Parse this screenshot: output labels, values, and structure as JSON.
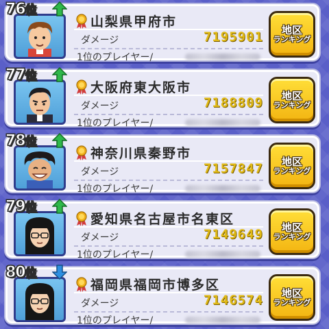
{
  "labels": {
    "rank_suffix": "位",
    "damage": "ダメージ",
    "top_player": "1位のプレイヤー/",
    "button_line1": "地区",
    "button_line2": "ランキング"
  },
  "entries": [
    {
      "rank": "76",
      "trend": "up",
      "region": "山梨県甲府市",
      "damage": "7195901",
      "avatar": "boy-brown-hair"
    },
    {
      "rank": "77",
      "trend": "up",
      "region": "大阪府東大阪市",
      "damage": "7188809",
      "avatar": "man-dark-hair"
    },
    {
      "rank": "78",
      "trend": "up",
      "region": "神奈川県秦野市",
      "damage": "7157847",
      "avatar": "boy-afro-grin"
    },
    {
      "rank": "79",
      "trend": "up",
      "region": "愛知県名古屋市名東区",
      "damage": "7149649",
      "avatar": "girl-glasses"
    },
    {
      "rank": "80",
      "trend": "down",
      "region": "福岡県福岡市博多区",
      "damage": "7146574",
      "avatar": "girl-glasses"
    }
  ],
  "colors": {
    "background": "#5a5fc8",
    "card": "#e9e9f6",
    "damage_value": "#e1ba16",
    "button": "#f3b512",
    "trend_up": "#2fb84a",
    "trend_down": "#2e8fe0"
  }
}
